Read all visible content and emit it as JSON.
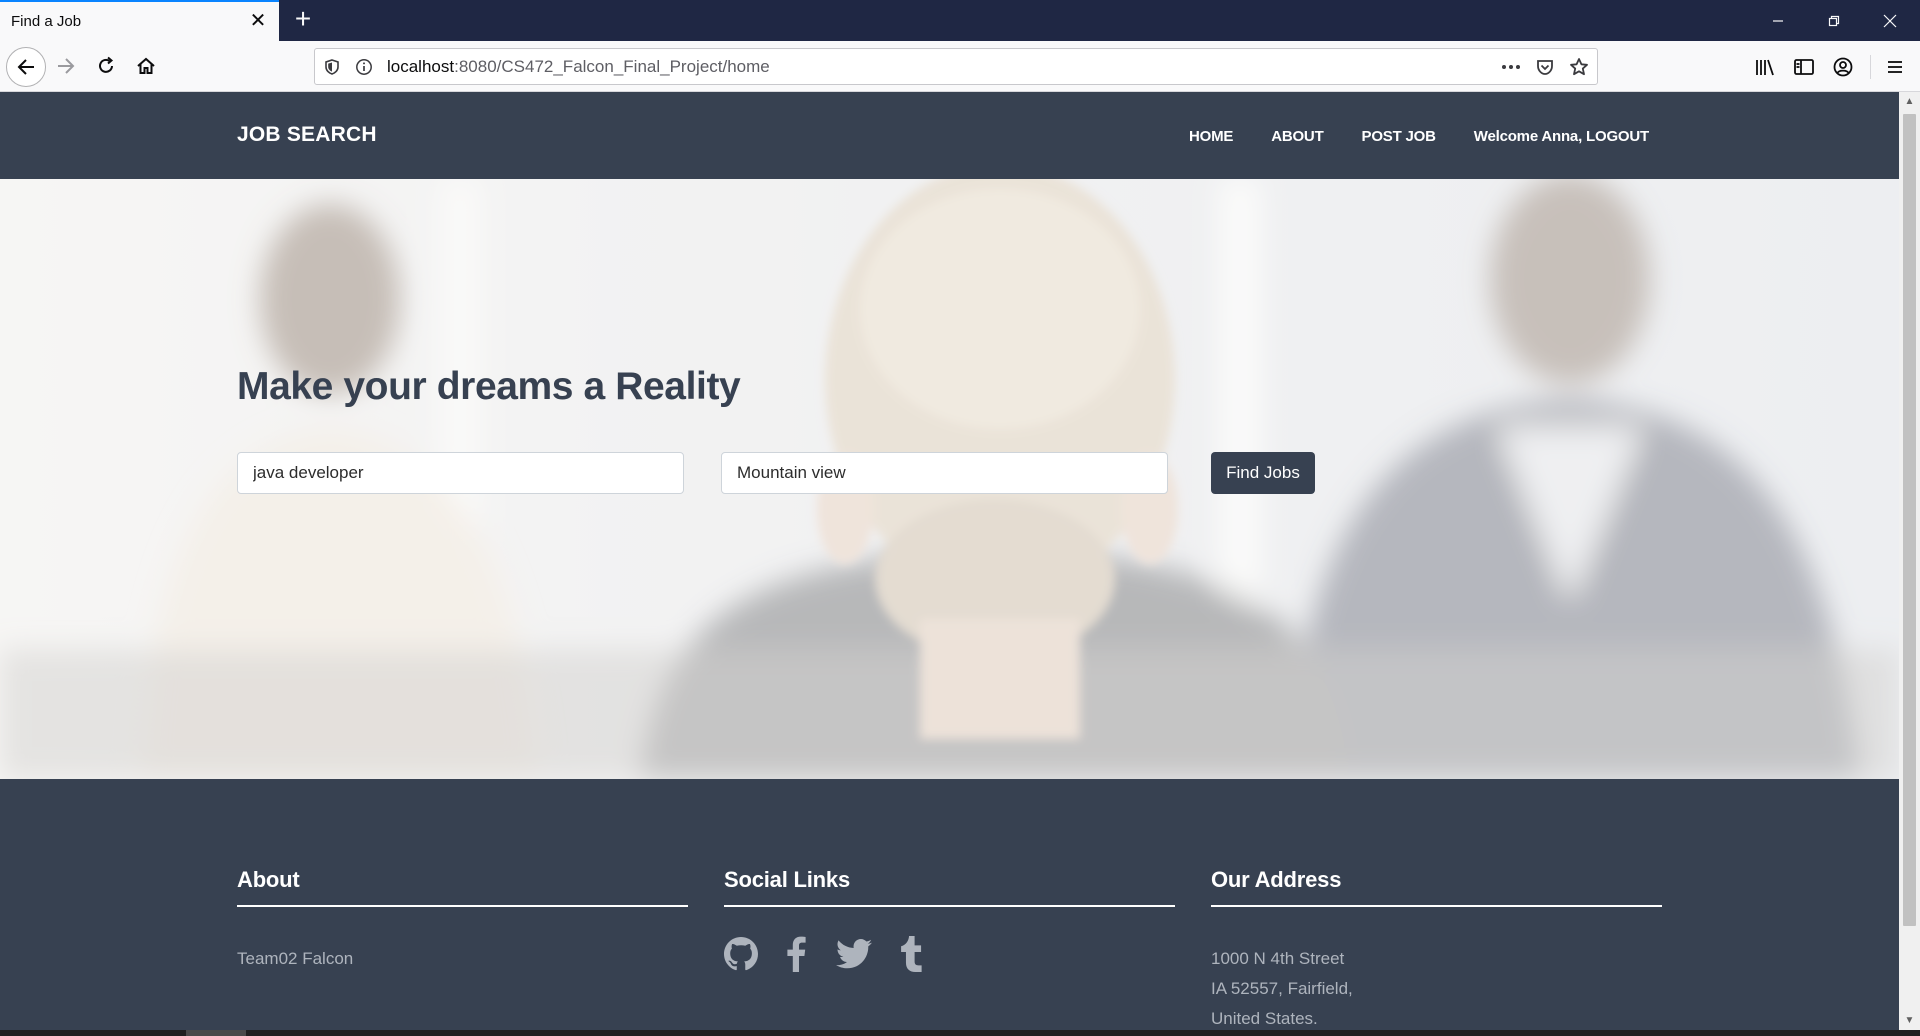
{
  "browser": {
    "tab_title": "Find a Job",
    "url_host": "localhost",
    "url_rest": ":8080/CS472_Falcon_Final_Project/home",
    "tab_close_glyph": "✕",
    "new_tab_glyph": "+"
  },
  "site": {
    "brand": "JOB SEARCH",
    "menu": [
      {
        "label": "HOME"
      },
      {
        "label": "ABOUT"
      },
      {
        "label": "POST JOB"
      },
      {
        "label": "Welcome Anna, LOGOUT"
      }
    ]
  },
  "hero": {
    "title": "Make your dreams a Reality",
    "search_keyword": "java developer",
    "search_location": "Mountain view",
    "button_label": "Find Jobs"
  },
  "footer": {
    "about": {
      "title": "About",
      "text": "Team02 Falcon"
    },
    "social": {
      "title": "Social Links",
      "icons": [
        "github-icon",
        "facebook-icon",
        "twitter-icon",
        "tumblr-icon"
      ]
    },
    "address": {
      "title": "Our Address",
      "lines": [
        "1000 N 4th Street",
        "IA 52557, Fairfield,",
        "United States."
      ]
    }
  },
  "colors": {
    "header_bg": "#374151",
    "footer_text": "#aeb4bd",
    "chrome_tabbar": "#1f2744",
    "tab_accent": "#0a84ff"
  }
}
